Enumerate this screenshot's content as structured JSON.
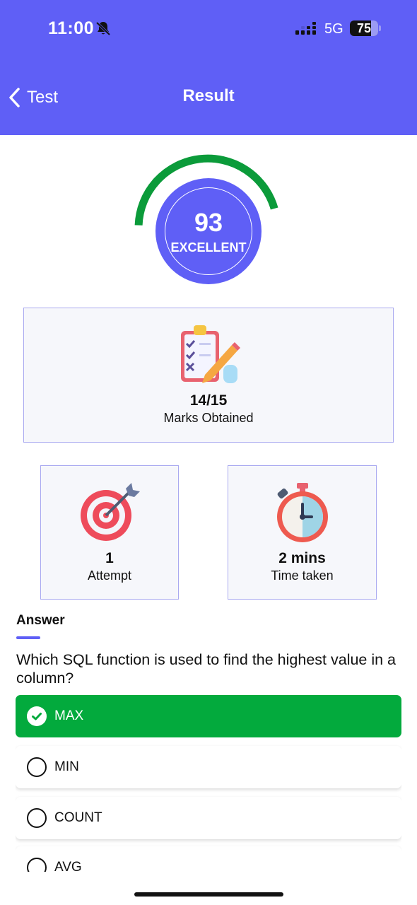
{
  "status_bar": {
    "time": "11:00",
    "network": "5G",
    "battery": "75",
    "battery_level": 0.75
  },
  "nav": {
    "back_label": "Test",
    "title": "Result"
  },
  "score": {
    "value": "93",
    "label": "EXCELLENT",
    "progress": 0.93
  },
  "marks": {
    "value": "14/15",
    "label": "Marks Obtained"
  },
  "attempts": {
    "value": "1",
    "label": "Attempt"
  },
  "time_taken": {
    "value": "2 mins",
    "label": "Time taken"
  },
  "answer": {
    "heading": "Answer",
    "question": "Which SQL function is used to find the highest value in a column?",
    "options": [
      {
        "label": "MAX",
        "correct": true
      },
      {
        "label": "MIN",
        "correct": false
      },
      {
        "label": "COUNT",
        "correct": false
      },
      {
        "label": "AVG",
        "correct": false
      }
    ]
  },
  "colors": {
    "primary": "#5f5ff6",
    "success": "#03aa3d",
    "card_bg": "#f6f7fb",
    "card_border": "#a9a9f0"
  }
}
